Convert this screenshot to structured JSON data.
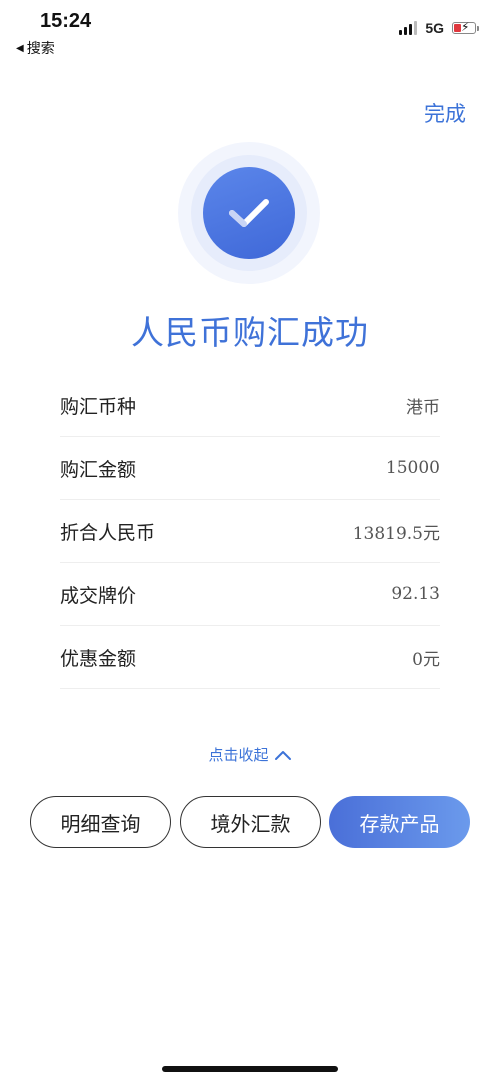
{
  "status_bar": {
    "time": "15:24",
    "back_label": "搜索",
    "network": "5G"
  },
  "header": {
    "done_label": "完成"
  },
  "result": {
    "title": "人民币购汇成功"
  },
  "details": [
    {
      "label": "购汇币种",
      "value": "港币"
    },
    {
      "label": "购汇金额",
      "value": "15000"
    },
    {
      "label": "折合人民币",
      "value": "13819.5元"
    },
    {
      "label": "成交牌价",
      "value": "92.13"
    },
    {
      "label": "优惠金额",
      "value": "0元"
    }
  ],
  "collapse": {
    "label": "点击收起"
  },
  "actions": {
    "detail_query": "明细查询",
    "overseas_remit": "境外汇款",
    "deposit_products": "存款产品"
  },
  "colors": {
    "accent": "#3c73d8",
    "battery_low": "#e0383e"
  }
}
